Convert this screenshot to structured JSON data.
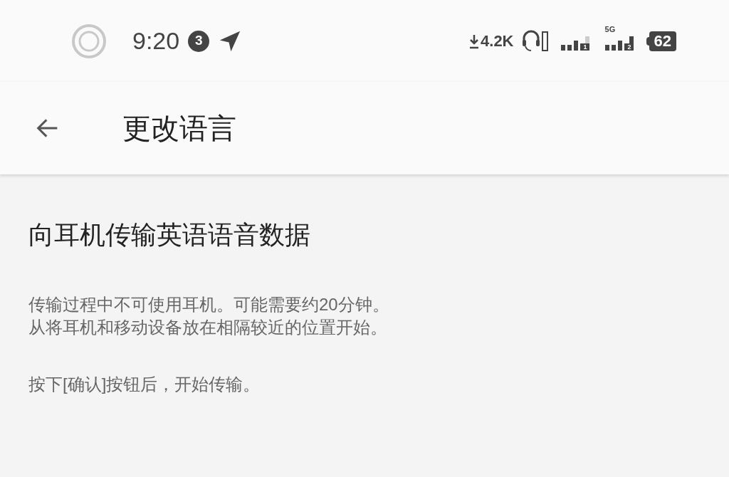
{
  "status_bar": {
    "time": "9:20",
    "notification_count": "3",
    "network_speed": "4.2K",
    "sim_1_label": "1",
    "sim_2_network": "5G",
    "sim_2_label": "2",
    "battery": "62"
  },
  "toolbar": {
    "title": "更改语言"
  },
  "content": {
    "heading": "向耳机传输英语语音数据",
    "paragraphs": [
      {
        "lines": [
          "传输过程中不可使用耳机。可能需要约20分钟。",
          "从将耳机和移动设备放在相隔较近的位置开始。"
        ]
      },
      {
        "lines": [
          "按下[确认]按钮后，开始传输。"
        ]
      }
    ]
  }
}
